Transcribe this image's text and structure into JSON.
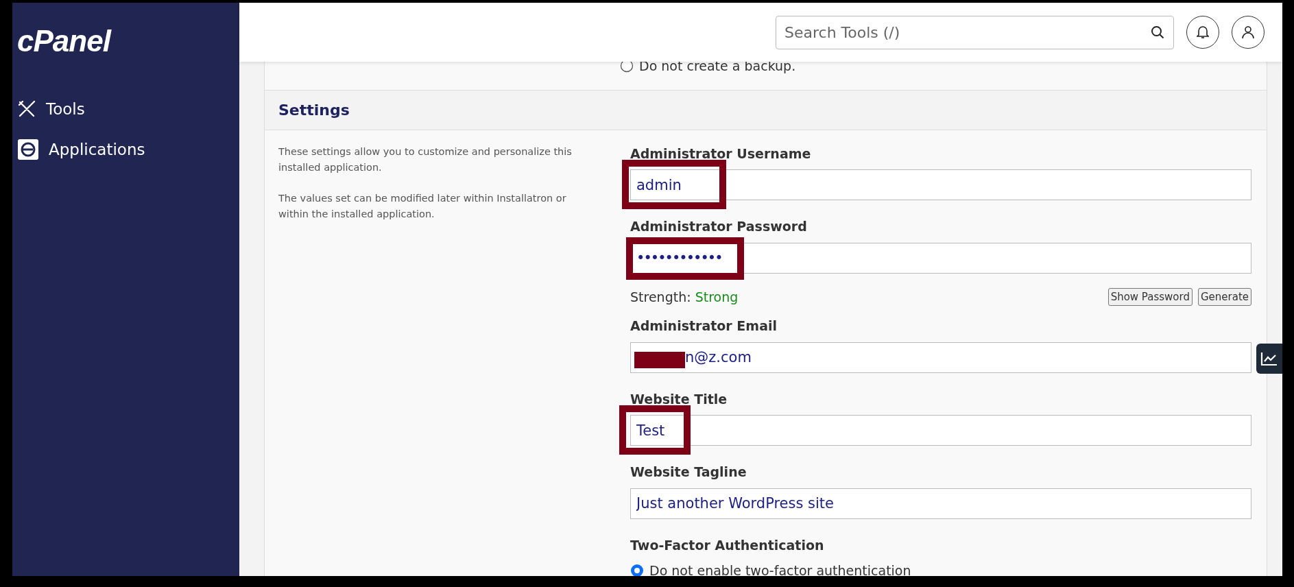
{
  "sidebar": {
    "logo": "cPanel",
    "items": [
      {
        "label": "Tools"
      },
      {
        "label": "Applications"
      }
    ]
  },
  "header": {
    "search": {
      "placeholder": "Search Tools (/)"
    }
  },
  "backup_option": {
    "label": "Do not create a backup.",
    "selected": false
  },
  "settings": {
    "title": "Settings",
    "description": [
      "These settings allow you to customize and personalize this installed application.",
      "The values set can be modified later within Installatron or within the installed application."
    ],
    "fields": [
      {
        "kind": "text",
        "label": "Administrator Username",
        "value": "admin",
        "highlighted": true,
        "redacted": false
      },
      {
        "kind": "password",
        "label": "Administrator Password",
        "value": "••••••••••••",
        "highlighted": true,
        "redacted": false,
        "strength_label": "Strength:",
        "strength": "Strong",
        "buttons": [
          "Show Password",
          "Generate"
        ]
      },
      {
        "kind": "text",
        "label": "Administrator Email",
        "value": "n@z.com",
        "highlighted": false,
        "redacted": true
      },
      {
        "kind": "text",
        "label": "Website Title",
        "value": "Test",
        "highlighted": true,
        "redacted": false
      },
      {
        "kind": "text",
        "label": "Website Tagline",
        "value": "Just another WordPress site",
        "highlighted": false,
        "redacted": false
      },
      {
        "kind": "radio",
        "label": "Two-Factor Authentication",
        "options": [
          {
            "label": "Do not enable two-factor authentication",
            "selected": true
          }
        ]
      }
    ]
  }
}
